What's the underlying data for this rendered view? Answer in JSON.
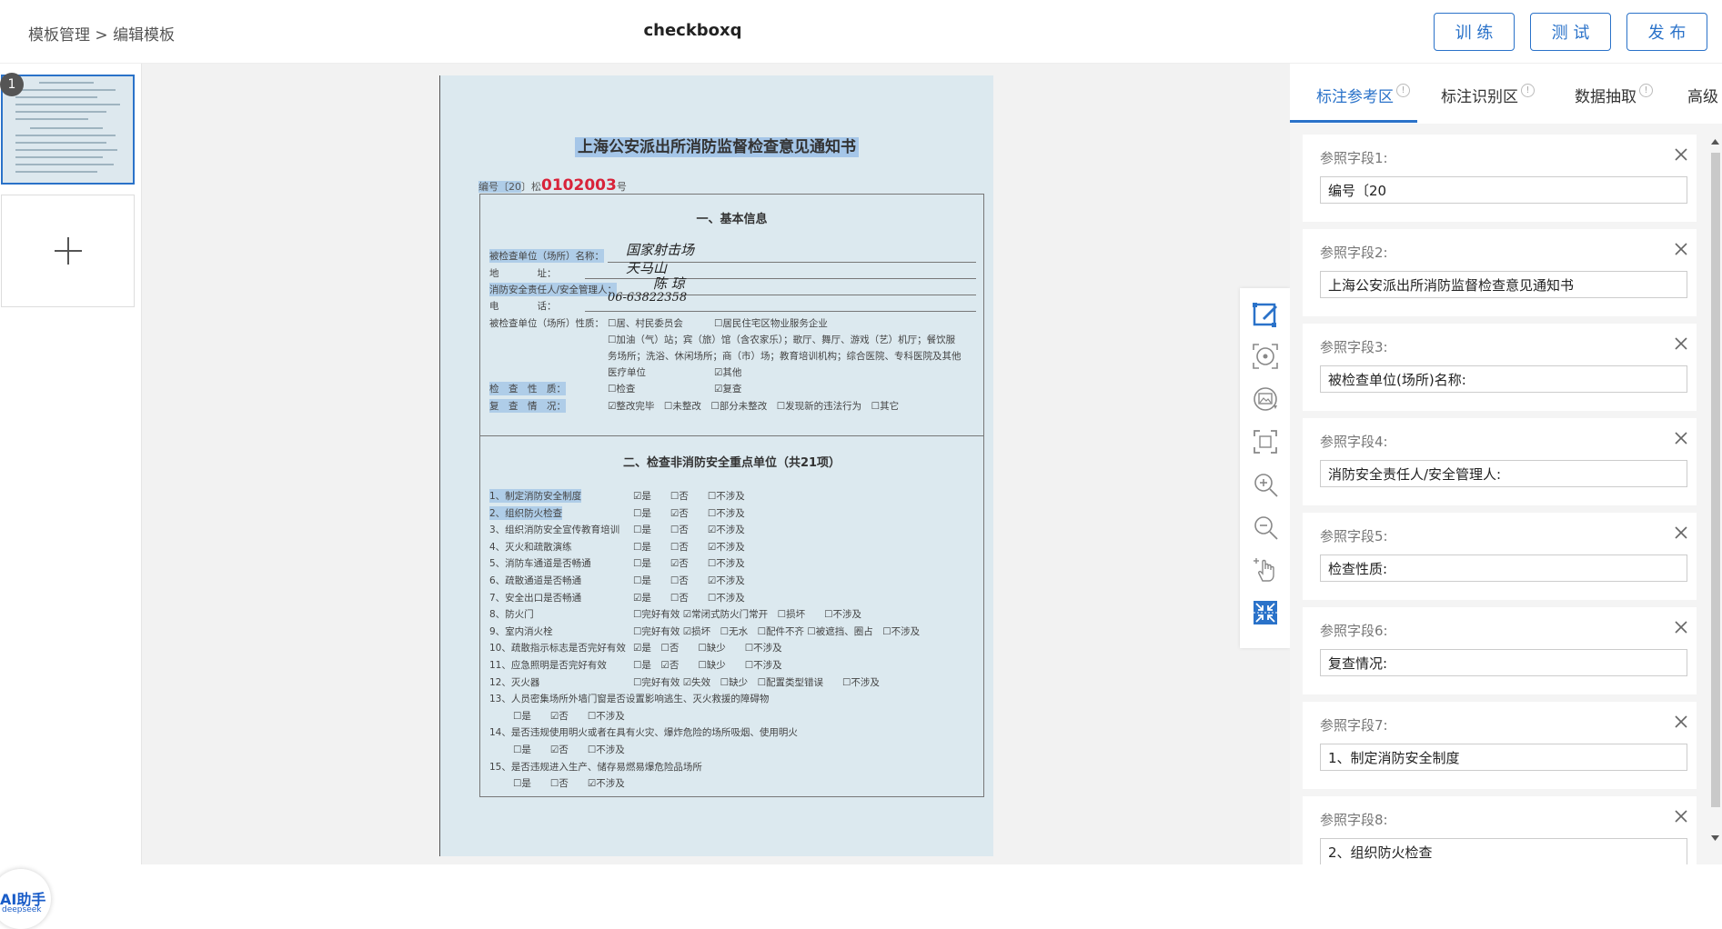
{
  "header": {
    "breadcrumb_root": "模板管理",
    "breadcrumb_sep": ">",
    "breadcrumb_current": "编辑模板",
    "title": "checkboxq",
    "train_label": "训 练",
    "test_label": "测 试",
    "publish_label": "发 布"
  },
  "pages": {
    "current_page_number": "1",
    "add_symbol": "+"
  },
  "ai_badge": {
    "title": "AI助手",
    "subtitle": "deepseek"
  },
  "document": {
    "title": "上海公安派出所消防监督检查意见通知书",
    "number_prefix": "编号〔20",
    "number_mid": "〕松",
    "number_red": "0102003",
    "number_suffix": "号",
    "section1": "一、基本信息",
    "unit_name_label": "被检查单位（场所）名称：",
    "unit_name_value": "国家射击场",
    "address_label": "地　　　　址：",
    "address_value": "天马山",
    "manager_label": "消防安全责任人/安全管理人：",
    "manager_value": "陈 琼",
    "phone_label": "电　　　　话：",
    "phone_value": "06-63822358",
    "nature_label": "被检查单位（场所）性质：",
    "nature_opt1": "☐居、村民委员会",
    "nature_opt2": "☐居民住宅区物业服务企业",
    "nature_line2": "☐加油（气）站；宾（旅）馆（含农家乐）；歌厅、舞厅、游戏（艺）机厅；餐饮服",
    "nature_line3": "务场所；洗浴、休闲场所；商（市）场；教育培训机构；综合医院、专科医院及其他",
    "nature_line4": "医疗单位",
    "nature_other": "☑其他",
    "check_nature_label": "检　查　性　质：",
    "check_opt1": "☐检查",
    "check_opt2": "☑复查",
    "review_label": "复　查　情　况：",
    "review_opts": "☑整改完毕　☐未整改　☐部分未整改　☐发现新的违法行为　☐其它",
    "section2": "二、检查非消防安全重点单位（共21项）",
    "items": [
      {
        "text": "1、制定消防安全制度",
        "opts": "☑是　　☐否　　☐不涉及"
      },
      {
        "text": "2、组织防火检查",
        "opts": "☐是　　☑否　　☐不涉及"
      },
      {
        "text": "3、组织消防安全宣传教育培训",
        "opts": "☐是　　☐否　　☑不涉及"
      },
      {
        "text": "4、灭火和疏散演练",
        "opts": "☐是　　☐否　　☑不涉及"
      },
      {
        "text": "5、消防车通道是否畅通",
        "opts": "☐是　　☑否　　☐不涉及"
      },
      {
        "text": "6、疏散通道是否畅通",
        "opts": "☐是　　☐否　　☑不涉及"
      },
      {
        "text": "7、安全出口是否畅通",
        "opts": "☑是　　☐否　　☐不涉及"
      },
      {
        "text": "8、防火门",
        "opts": "☐完好有效 ☑常闭式防火门常开　☐损坏　　☐不涉及"
      },
      {
        "text": "9、室内消火栓",
        "opts": "☐完好有效 ☑损坏　☐无水　☐配件不齐 ☐被遮挡、圈占　☐不涉及"
      },
      {
        "text": "10、疏散指示标志是否完好有效",
        "opts": "☑是　☐否　　☐缺少　　☐不涉及"
      },
      {
        "text": "11、应急照明是否完好有效",
        "opts": "☐是　☑否　　☐缺少　　☐不涉及"
      },
      {
        "text": "12、灭火器",
        "opts": "☐完好有效 ☑失效　☐缺少　☐配置类型错误　　☐不涉及"
      },
      {
        "text": "13、人员密集场所外墙门窗是否设置影响逃生、灭火救援的障碍物",
        "opts": ""
      },
      {
        "text": "",
        "opts": "☐是　　☑否　　☐不涉及"
      },
      {
        "text": "14、是否违规使用明火或者在具有火灾、爆炸危险的场所吸烟、使用明火",
        "opts": ""
      },
      {
        "text": "",
        "opts": "☐是　　☑否　　☐不涉及"
      },
      {
        "text": "15、是否违规进入生产、储存易燃易爆危险品场所",
        "opts": ""
      },
      {
        "text": "",
        "opts": "☐是　　☐否　　☑不涉及"
      }
    ]
  },
  "tools": [
    {
      "name": "draw-box-tool"
    },
    {
      "name": "locate-tool"
    },
    {
      "name": "image-rotate-tool"
    },
    {
      "name": "fit-screen-tool"
    },
    {
      "name": "zoom-in-tool"
    },
    {
      "name": "zoom-out-tool"
    },
    {
      "name": "pan-hand-tool"
    },
    {
      "name": "collapse-tool"
    }
  ],
  "rpanel": {
    "tabs": [
      "标注参考区",
      "标注识别区",
      "数据抽取",
      "高级"
    ],
    "info_mark": "!",
    "fields": [
      {
        "label": "参照字段1:",
        "value": "编号〔20"
      },
      {
        "label": "参照字段2:",
        "value": "上海公安派出所消防监督检查意见通知书"
      },
      {
        "label": "参照字段3:",
        "value": "被检查单位(场所)名称:"
      },
      {
        "label": "参照字段4:",
        "value": "消防安全责任人/安全管理人:"
      },
      {
        "label": "参照字段5:",
        "value": "检查性质:"
      },
      {
        "label": "参照字段6:",
        "value": "复查情况:"
      },
      {
        "label": "参照字段7:",
        "value": "1、制定消防安全制度"
      },
      {
        "label": "参照字段8:",
        "value": "2、组织防火检查"
      }
    ]
  },
  "colors": {
    "accent": "#2a72c9",
    "highlight": "#78aae1",
    "doc_bg": "#dce9ef",
    "red": "#d8233a"
  }
}
